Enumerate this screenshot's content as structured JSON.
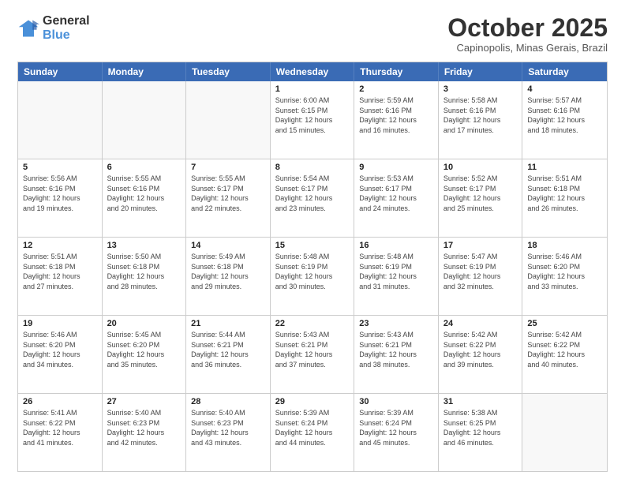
{
  "logo": {
    "general": "General",
    "blue": "Blue"
  },
  "title": "October 2025",
  "subtitle": "Capinopolis, Minas Gerais, Brazil",
  "days_of_week": [
    "Sunday",
    "Monday",
    "Tuesday",
    "Wednesday",
    "Thursday",
    "Friday",
    "Saturday"
  ],
  "weeks": [
    [
      {
        "day": "",
        "info": ""
      },
      {
        "day": "",
        "info": ""
      },
      {
        "day": "",
        "info": ""
      },
      {
        "day": "1",
        "info": "Sunrise: 6:00 AM\nSunset: 6:15 PM\nDaylight: 12 hours\nand 15 minutes."
      },
      {
        "day": "2",
        "info": "Sunrise: 5:59 AM\nSunset: 6:16 PM\nDaylight: 12 hours\nand 16 minutes."
      },
      {
        "day": "3",
        "info": "Sunrise: 5:58 AM\nSunset: 6:16 PM\nDaylight: 12 hours\nand 17 minutes."
      },
      {
        "day": "4",
        "info": "Sunrise: 5:57 AM\nSunset: 6:16 PM\nDaylight: 12 hours\nand 18 minutes."
      }
    ],
    [
      {
        "day": "5",
        "info": "Sunrise: 5:56 AM\nSunset: 6:16 PM\nDaylight: 12 hours\nand 19 minutes."
      },
      {
        "day": "6",
        "info": "Sunrise: 5:55 AM\nSunset: 6:16 PM\nDaylight: 12 hours\nand 20 minutes."
      },
      {
        "day": "7",
        "info": "Sunrise: 5:55 AM\nSunset: 6:17 PM\nDaylight: 12 hours\nand 22 minutes."
      },
      {
        "day": "8",
        "info": "Sunrise: 5:54 AM\nSunset: 6:17 PM\nDaylight: 12 hours\nand 23 minutes."
      },
      {
        "day": "9",
        "info": "Sunrise: 5:53 AM\nSunset: 6:17 PM\nDaylight: 12 hours\nand 24 minutes."
      },
      {
        "day": "10",
        "info": "Sunrise: 5:52 AM\nSunset: 6:17 PM\nDaylight: 12 hours\nand 25 minutes."
      },
      {
        "day": "11",
        "info": "Sunrise: 5:51 AM\nSunset: 6:18 PM\nDaylight: 12 hours\nand 26 minutes."
      }
    ],
    [
      {
        "day": "12",
        "info": "Sunrise: 5:51 AM\nSunset: 6:18 PM\nDaylight: 12 hours\nand 27 minutes."
      },
      {
        "day": "13",
        "info": "Sunrise: 5:50 AM\nSunset: 6:18 PM\nDaylight: 12 hours\nand 28 minutes."
      },
      {
        "day": "14",
        "info": "Sunrise: 5:49 AM\nSunset: 6:18 PM\nDaylight: 12 hours\nand 29 minutes."
      },
      {
        "day": "15",
        "info": "Sunrise: 5:48 AM\nSunset: 6:19 PM\nDaylight: 12 hours\nand 30 minutes."
      },
      {
        "day": "16",
        "info": "Sunrise: 5:48 AM\nSunset: 6:19 PM\nDaylight: 12 hours\nand 31 minutes."
      },
      {
        "day": "17",
        "info": "Sunrise: 5:47 AM\nSunset: 6:19 PM\nDaylight: 12 hours\nand 32 minutes."
      },
      {
        "day": "18",
        "info": "Sunrise: 5:46 AM\nSunset: 6:20 PM\nDaylight: 12 hours\nand 33 minutes."
      }
    ],
    [
      {
        "day": "19",
        "info": "Sunrise: 5:46 AM\nSunset: 6:20 PM\nDaylight: 12 hours\nand 34 minutes."
      },
      {
        "day": "20",
        "info": "Sunrise: 5:45 AM\nSunset: 6:20 PM\nDaylight: 12 hours\nand 35 minutes."
      },
      {
        "day": "21",
        "info": "Sunrise: 5:44 AM\nSunset: 6:21 PM\nDaylight: 12 hours\nand 36 minutes."
      },
      {
        "day": "22",
        "info": "Sunrise: 5:43 AM\nSunset: 6:21 PM\nDaylight: 12 hours\nand 37 minutes."
      },
      {
        "day": "23",
        "info": "Sunrise: 5:43 AM\nSunset: 6:21 PM\nDaylight: 12 hours\nand 38 minutes."
      },
      {
        "day": "24",
        "info": "Sunrise: 5:42 AM\nSunset: 6:22 PM\nDaylight: 12 hours\nand 39 minutes."
      },
      {
        "day": "25",
        "info": "Sunrise: 5:42 AM\nSunset: 6:22 PM\nDaylight: 12 hours\nand 40 minutes."
      }
    ],
    [
      {
        "day": "26",
        "info": "Sunrise: 5:41 AM\nSunset: 6:22 PM\nDaylight: 12 hours\nand 41 minutes."
      },
      {
        "day": "27",
        "info": "Sunrise: 5:40 AM\nSunset: 6:23 PM\nDaylight: 12 hours\nand 42 minutes."
      },
      {
        "day": "28",
        "info": "Sunrise: 5:40 AM\nSunset: 6:23 PM\nDaylight: 12 hours\nand 43 minutes."
      },
      {
        "day": "29",
        "info": "Sunrise: 5:39 AM\nSunset: 6:24 PM\nDaylight: 12 hours\nand 44 minutes."
      },
      {
        "day": "30",
        "info": "Sunrise: 5:39 AM\nSunset: 6:24 PM\nDaylight: 12 hours\nand 45 minutes."
      },
      {
        "day": "31",
        "info": "Sunrise: 5:38 AM\nSunset: 6:25 PM\nDaylight: 12 hours\nand 46 minutes."
      },
      {
        "day": "",
        "info": ""
      }
    ]
  ]
}
